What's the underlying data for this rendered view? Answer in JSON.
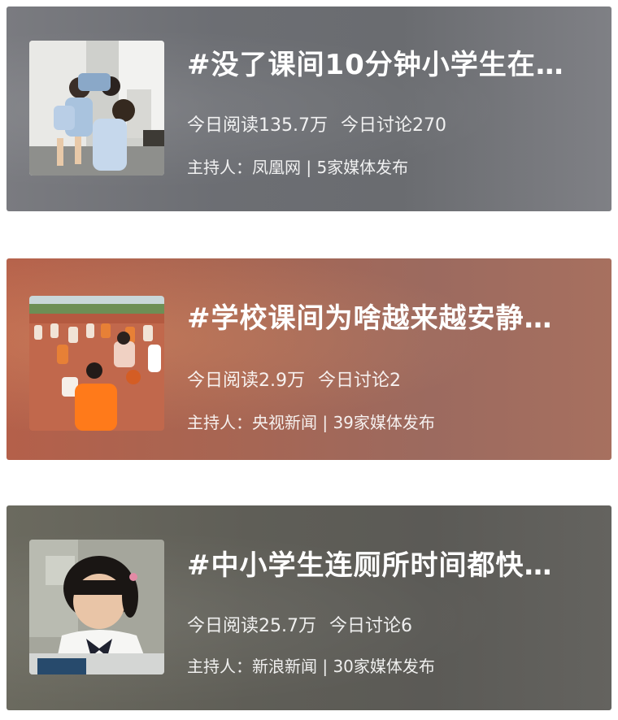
{
  "topics": [
    {
      "title": "#没了课间10分钟小学生在…",
      "reads": "今日阅读135.7万",
      "discussions": "今日讨论270",
      "host": "主持人：凤凰网 | 5家媒体发布",
      "thumbnail_icon": "photo-children-in-restroom"
    },
    {
      "title": "#学校课间为啥越来越安静…",
      "reads": "今日阅读2.9万",
      "discussions": "今日讨论2",
      "host": "主持人：央视新闻 | 39家媒体发布",
      "thumbnail_icon": "photo-kids-playing-basketball"
    },
    {
      "title": "#中小学生连厕所时间都快…",
      "reads": "今日阅读25.7万",
      "discussions": "今日讨论6",
      "host": "主持人：新浪新闻 | 30家媒体发布",
      "thumbnail_icon": "photo-girl-reading"
    }
  ]
}
